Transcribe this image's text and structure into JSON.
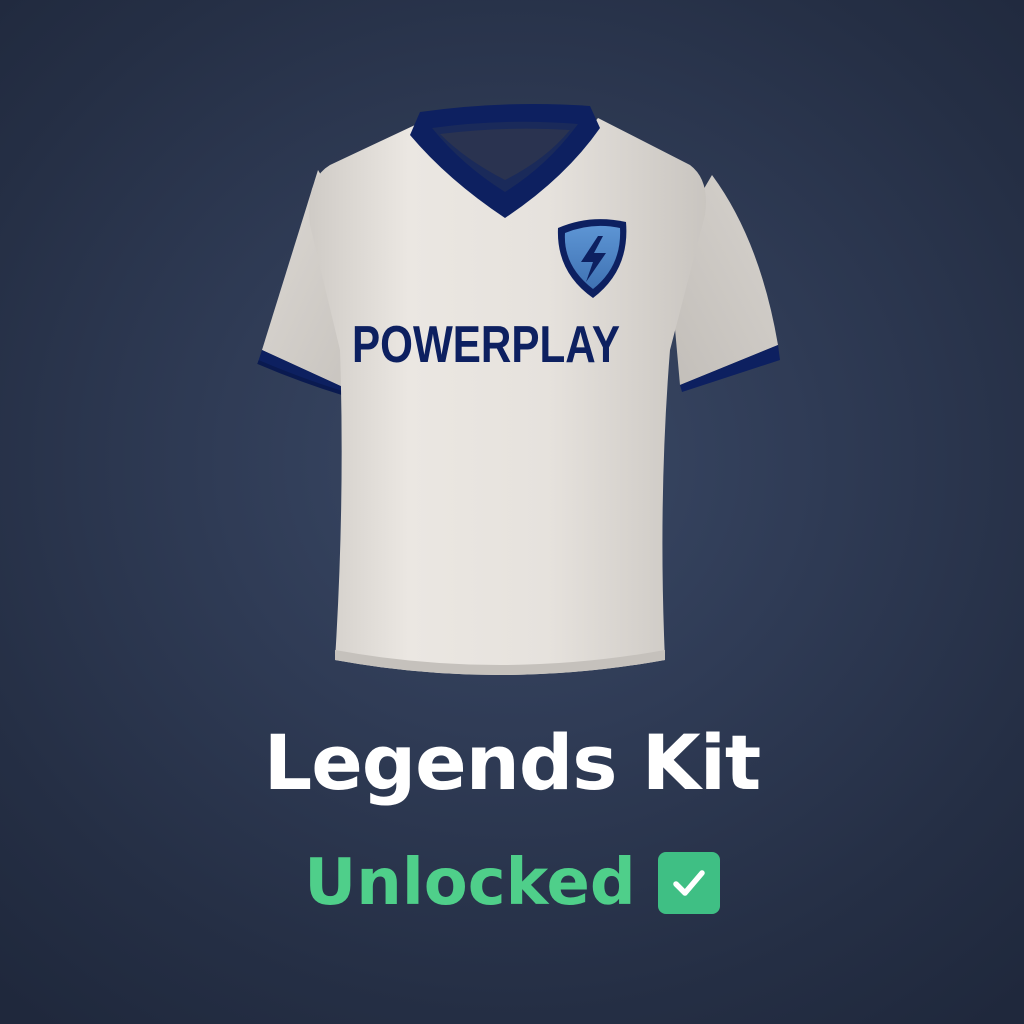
{
  "item": {
    "name": "Legends Kit",
    "status": "Unlocked",
    "sponsor_text": "POWERPLAY",
    "crest_icon": "lightning-shield-icon",
    "status_icon": "check-icon"
  },
  "colors": {
    "jersey_body": "#e8e4df",
    "trim": "#0d2060",
    "crest": "#4f86c6",
    "status": "#4fcf8a",
    "title": "#ffffff"
  }
}
